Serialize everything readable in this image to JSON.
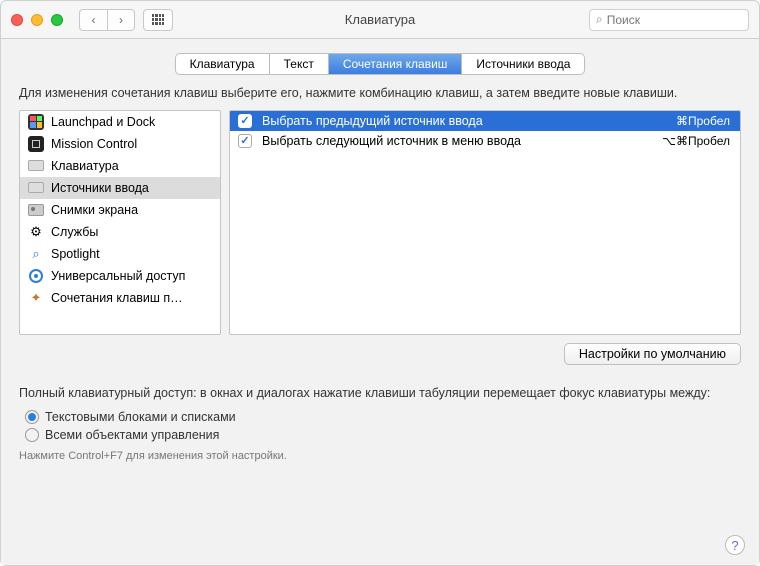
{
  "window": {
    "title": "Клавиатура"
  },
  "search": {
    "placeholder": "Поиск"
  },
  "tabs": [
    {
      "label": "Клавиатура"
    },
    {
      "label": "Текст"
    },
    {
      "label": "Сочетания клавиш"
    },
    {
      "label": "Источники ввода"
    }
  ],
  "instruction": "Для изменения сочетания клавиш выберите его, нажмите комбинацию клавиш, а затем введите новые клавиши.",
  "categories": [
    {
      "label": "Launchpad и Dock",
      "icon": "launchpad",
      "color": "#666"
    },
    {
      "label": "Mission Control",
      "icon": "mission",
      "color": "#444"
    },
    {
      "label": "Клавиатура",
      "icon": "keyboard",
      "color": "#888"
    },
    {
      "label": "Источники ввода",
      "icon": "input",
      "color": "#888",
      "selected": true
    },
    {
      "label": "Снимки экрана",
      "icon": "screenshot",
      "color": "#888"
    },
    {
      "label": "Службы",
      "icon": "services",
      "color": "#888"
    },
    {
      "label": "Spotlight",
      "icon": "spotlight",
      "color": "#2a7de1"
    },
    {
      "label": "Универсальный доступ",
      "icon": "accessibility",
      "color": "#2a7de1"
    },
    {
      "label": "Сочетания клавиш п…",
      "icon": "appshortcuts",
      "color": "#c87a2a"
    }
  ],
  "shortcuts": [
    {
      "checked": true,
      "label": "Выбрать предыдущий источник ввода",
      "keys": "⌘Пробел",
      "selected": true
    },
    {
      "checked": true,
      "label": "Выбрать следующий источник в меню ввода",
      "keys": "⌥⌘Пробел",
      "selected": false
    }
  ],
  "defaults_btn": "Настройки по умолчанию",
  "kbaccess": {
    "desc": "Полный клавиатурный доступ: в окнах и диалогах нажатие клавиши табуляции перемещает фокус клавиатуры между:",
    "opt1": "Текстовыми блоками и списками",
    "opt2": "Всеми объектами управления",
    "hint": "Нажмите Control+F7 для изменения этой настройки."
  }
}
